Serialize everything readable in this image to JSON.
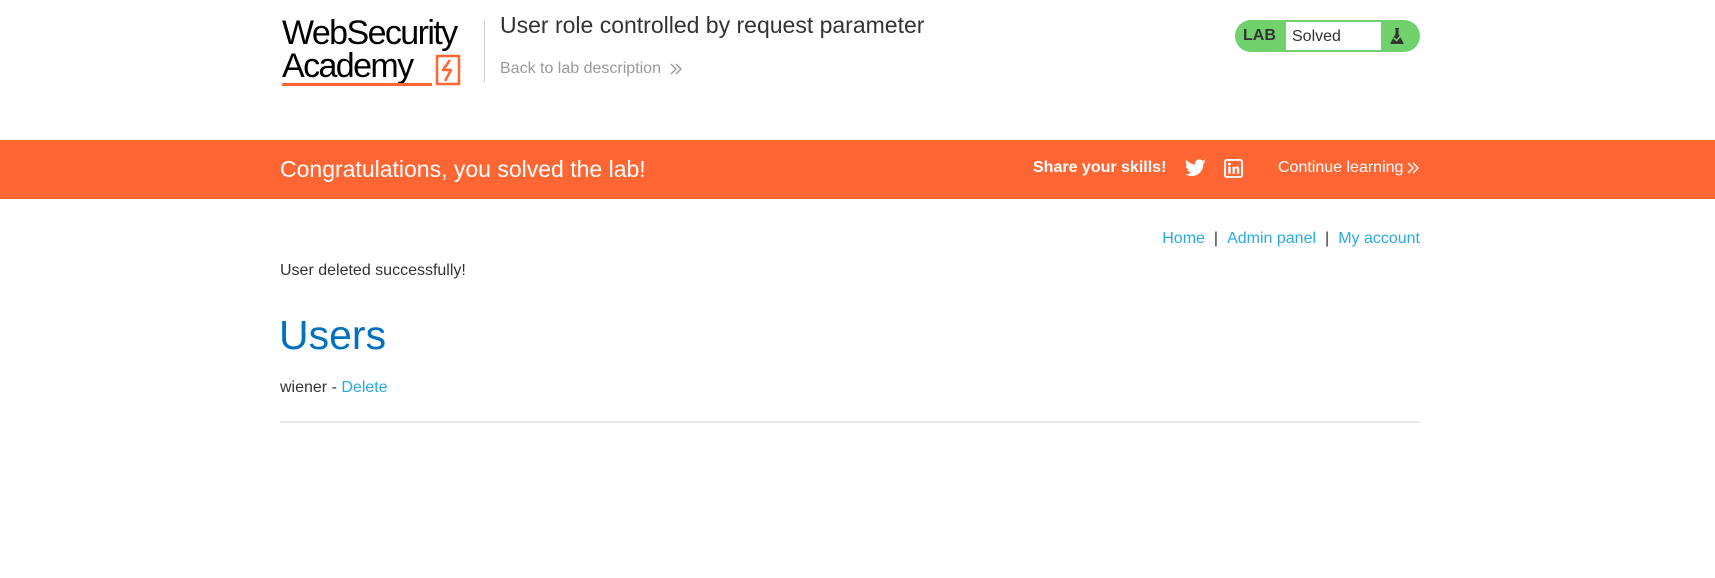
{
  "header": {
    "logo": {
      "line1": "WebSecurity",
      "line2": "Academy"
    },
    "lab_title": "User role controlled by request parameter",
    "back_link": "Back to lab description",
    "status": {
      "badge": "LAB",
      "value": "Solved",
      "icon": "flask-icon"
    }
  },
  "banner": {
    "message": "Congratulations, you solved the lab!",
    "share_label": "Share your skills!",
    "share_icons": [
      "twitter-icon",
      "linkedin-icon"
    ],
    "continue_label": "Continue learning"
  },
  "nav": {
    "home": "Home",
    "admin_panel": "Admin panel",
    "my_account": "My account",
    "separator": "|"
  },
  "main": {
    "message": "User deleted successfully!",
    "heading": "Users",
    "users": [
      {
        "name": "wiener",
        "separator": "-",
        "action": "Delete"
      }
    ]
  },
  "colors": {
    "accent_orange": "#ff6633",
    "status_green": "#70d16d",
    "link_blue": "#29abe2",
    "heading_blue": "#0071bc"
  }
}
